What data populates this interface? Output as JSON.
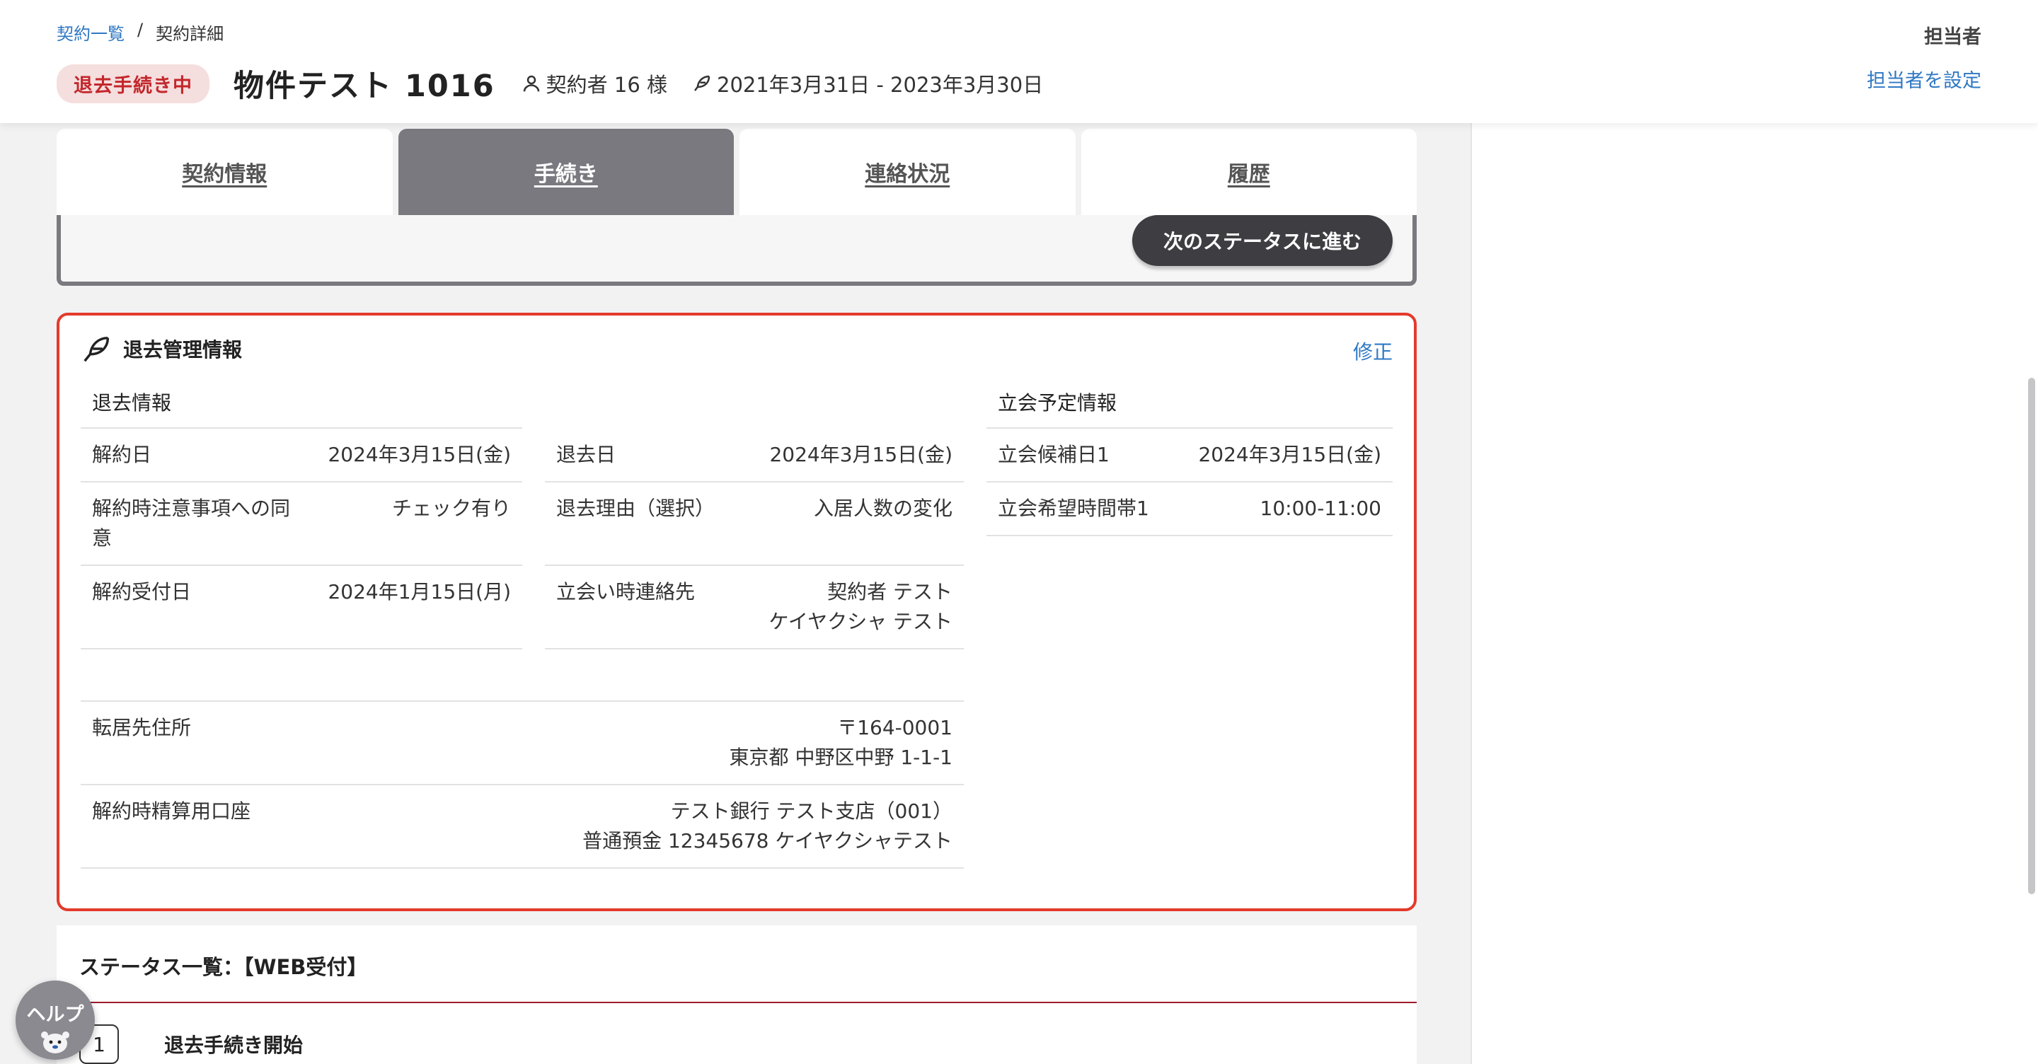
{
  "breadcrumb": {
    "list": "契約一覧",
    "separator": "/",
    "current": "契約詳細"
  },
  "header": {
    "status_badge": "退去手続き中",
    "property_name": "物件テスト 1016",
    "contractor": "契約者 16 様",
    "period": "2021年3月31日 - 2023年3月30日",
    "assignee_label": "担当者",
    "assignee_link": "担当者を設定"
  },
  "tabs": [
    {
      "label": "契約情報",
      "active": false
    },
    {
      "label": "手続き",
      "active": true
    },
    {
      "label": "連絡状況",
      "active": false
    },
    {
      "label": "履歴",
      "active": false
    }
  ],
  "status_band": {
    "next_button": "次のステータスに進む"
  },
  "moveout_card": {
    "title": "退去管理情報",
    "edit": "修正",
    "moveout_info": {
      "heading": "退去情報",
      "left": [
        {
          "label": "解約日",
          "value": "2024年3月15日(金)"
        },
        {
          "label": "解約時注意事項への同意",
          "value": "チェック有り"
        },
        {
          "label": "解約受付日",
          "value": "2024年1月15日(月)"
        }
      ],
      "right": [
        {
          "label": "退去日",
          "value": "2024年3月15日(金)"
        },
        {
          "label": "退去理由（選択）",
          "value": "入居人数の変化"
        },
        {
          "label": "立会い時連絡先",
          "value_line1": "契約者 テスト",
          "value_line2": "ケイヤクシャ テスト"
        }
      ],
      "wide": [
        {
          "label": "転居先住所",
          "value_line1": "〒164-0001",
          "value_line2": "東京都 中野区中野 1-1-1"
        },
        {
          "label": "解約時精算用口座",
          "value_line1": "テスト銀行 テスト支店（001）",
          "value_line2": "普通預金 12345678 ケイヤクシャテスト"
        }
      ]
    },
    "inspection_info": {
      "heading": "立会予定情報",
      "rows": [
        {
          "label": "立会候補日1",
          "value": "2024年3月15日(金)"
        },
        {
          "label": "立会希望時間帯1",
          "value": "10:00-11:00"
        }
      ]
    }
  },
  "status_list": {
    "title": "ステータス一覧：【WEB受付】",
    "steps": [
      {
        "number": "1",
        "label": "退去手続き開始"
      }
    ]
  },
  "help": {
    "label": "ヘルプ"
  },
  "colors": {
    "accent_red": "#e33a2c",
    "link_blue": "#2f78c4",
    "active_tab": "#7a797f",
    "badge_bg": "#f5dede",
    "badge_text": "#c3272b"
  }
}
